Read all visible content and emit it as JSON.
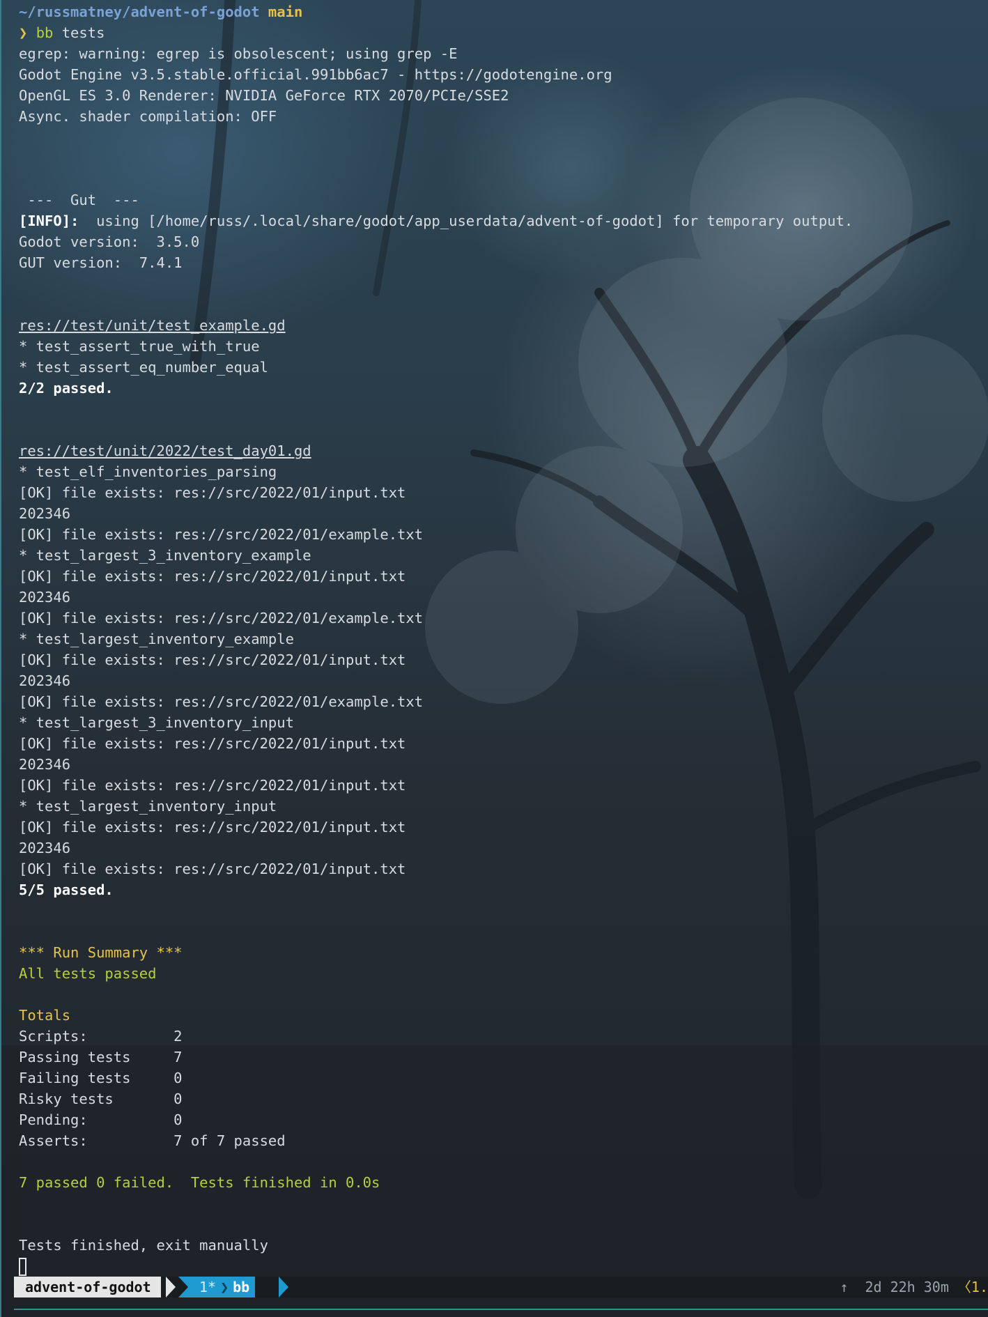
{
  "prompt": {
    "path": "~/russmatney/advent-of-godot",
    "branch": "main",
    "symbol": "❯",
    "command_name": "bb",
    "command_args": "tests"
  },
  "output": {
    "egrep_warning": "egrep: warning: egrep is obsolescent; using grep -E",
    "engine": "Godot Engine v3.5.stable.official.991bb6ac7 - https://godotengine.org",
    "renderer": "OpenGL ES 3.0 Renderer: NVIDIA GeForce RTX 2070/PCIe/SSE2",
    "async": "Async. shader compilation: OFF",
    "gut_header": " ---  Gut  ---",
    "info_tag": "[INFO]:",
    "info_text": "  using [/home/russ/.local/share/godot/app_userdata/advent-of-godot] for temporary output.",
    "godot_version": "Godot version:  3.5.0",
    "gut_version": "GUT version:  7.4.1",
    "script1": {
      "path": "res://test/unit/test_example.gd",
      "tests": [
        "* test_assert_true_with_true",
        "* test_assert_eq_number_equal"
      ],
      "result": "2/2 passed."
    },
    "script2": {
      "path": "res://test/unit/2022/test_day01.gd",
      "lines": [
        "* test_elf_inventories_parsing",
        "[OK] file exists: res://src/2022/01/input.txt",
        "202346",
        "[OK] file exists: res://src/2022/01/example.txt",
        "* test_largest_3_inventory_example",
        "[OK] file exists: res://src/2022/01/input.txt",
        "202346",
        "[OK] file exists: res://src/2022/01/example.txt",
        "* test_largest_inventory_example",
        "[OK] file exists: res://src/2022/01/input.txt",
        "202346",
        "[OK] file exists: res://src/2022/01/example.txt",
        "* test_largest_3_inventory_input",
        "[OK] file exists: res://src/2022/01/input.txt",
        "202346",
        "[OK] file exists: res://src/2022/01/input.txt",
        "* test_largest_inventory_input",
        "[OK] file exists: res://src/2022/01/input.txt",
        "202346",
        "[OK] file exists: res://src/2022/01/input.txt"
      ],
      "result": "5/5 passed."
    },
    "summary_header": "*** Run Summary ***",
    "summary_status": "All tests passed",
    "totals_header": "Totals",
    "totals": [
      "Scripts:          2",
      "Passing tests     7",
      "Failing tests     0",
      "Risky tests       0",
      "Pending:          0",
      "Asserts:          7 of 7 passed"
    ],
    "final_line": "7 passed 0 failed.  Tests finished in 0.0s",
    "exit_message": "Tests finished, exit manually"
  },
  "statusbar": {
    "session": "advent-of-godot",
    "window_index": "1*",
    "window_name": "bb",
    "right_info": "↑  2d 22h 30m ",
    "right_clock": "〈1."
  },
  "colors": {
    "accent_yellow": "#e6c24a",
    "accent_green": "#b7d13a",
    "path_blue": "#7aa2d6",
    "window_tab_blue": "#1f9ad1"
  }
}
